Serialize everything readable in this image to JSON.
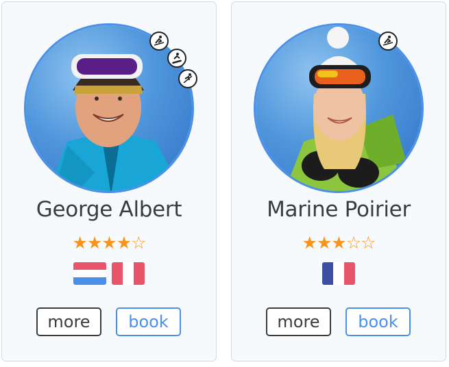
{
  "instructors": [
    {
      "name": "George Albert",
      "rating": 4,
      "max_rating": 5,
      "stars_text": [
        "★",
        "★",
        "★",
        "★",
        "☆"
      ],
      "languages": [
        "nl-flag",
        "fr-flag"
      ],
      "sports": [
        "ski-icon",
        "snowboard-icon",
        "freestyle-icon"
      ],
      "more_label": "more",
      "book_label": "book"
    },
    {
      "name": "Marine Poirier",
      "rating": 3,
      "max_rating": 5,
      "stars_text": [
        "★",
        "★",
        "★",
        "☆",
        "☆"
      ],
      "languages": [
        "fr-flag"
      ],
      "sports": [
        "ski-icon"
      ],
      "more_label": "more",
      "book_label": "book"
    }
  ],
  "colors": {
    "accent": "#4a8fe8",
    "star": "#f7941d",
    "text": "#3b3b3b",
    "card_bg": "#f7fafd",
    "card_border": "#d5d9de"
  }
}
